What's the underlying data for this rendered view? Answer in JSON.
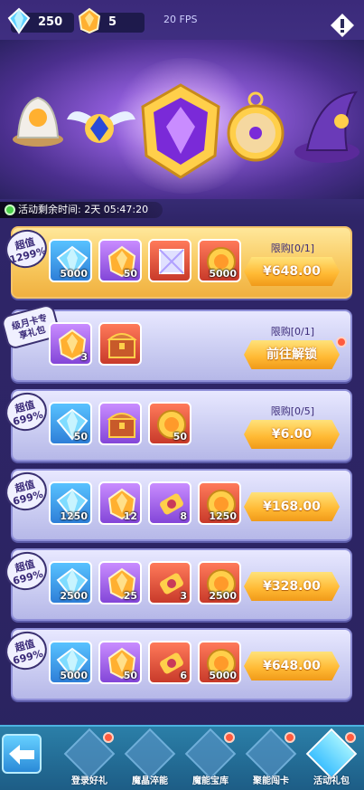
{
  "resources": {
    "crystal": "250",
    "amber": "5"
  },
  "fps": "20 FPS",
  "timer": "活动剩余时间: 2天 05:47:20",
  "packs": [
    {
      "badge": "超值\n1299%",
      "limit": "限购[0/1]",
      "price": "¥648.00",
      "items": [
        {
          "type": "crystal",
          "color": "blue",
          "qty": "5000"
        },
        {
          "type": "amber",
          "color": "purple",
          "qty": "50"
        },
        {
          "type": "box",
          "color": "red",
          "qty": ""
        },
        {
          "type": "coin",
          "color": "red",
          "qty": "5000"
        }
      ]
    },
    {
      "badge": "级月卡专\n享礼包",
      "limit": "限购[0/1]",
      "price": "前往解锁",
      "items": [
        {
          "type": "amber",
          "color": "purple",
          "qty": "3"
        },
        {
          "type": "chest",
          "color": "red",
          "qty": ""
        }
      ]
    },
    {
      "badge": "超值\n699%",
      "limit": "限购[0/5]",
      "price": "¥6.00",
      "items": [
        {
          "type": "crystal",
          "color": "blue",
          "qty": "50"
        },
        {
          "type": "chest",
          "color": "purple",
          "qty": ""
        },
        {
          "type": "coin",
          "color": "red",
          "qty": "50"
        }
      ]
    },
    {
      "badge": "超值\n699%",
      "limit": "",
      "price": "¥168.00",
      "items": [
        {
          "type": "crystal",
          "color": "blue",
          "qty": "1250"
        },
        {
          "type": "amber",
          "color": "purple",
          "qty": "12"
        },
        {
          "type": "scroll",
          "color": "purple",
          "qty": "8"
        },
        {
          "type": "coin",
          "color": "red",
          "qty": "1250"
        }
      ]
    },
    {
      "badge": "超值\n699%",
      "limit": "",
      "price": "¥328.00",
      "items": [
        {
          "type": "crystal",
          "color": "blue",
          "qty": "2500"
        },
        {
          "type": "amber",
          "color": "purple",
          "qty": "25"
        },
        {
          "type": "scroll",
          "color": "red",
          "qty": "3"
        },
        {
          "type": "coin",
          "color": "red",
          "qty": "2500"
        }
      ]
    },
    {
      "badge": "超值\n699%",
      "limit": "",
      "price": "¥648.00",
      "items": [
        {
          "type": "crystal",
          "color": "blue",
          "qty": "5000"
        },
        {
          "type": "amber",
          "color": "purple",
          "qty": "50"
        },
        {
          "type": "scroll",
          "color": "red",
          "qty": "6"
        },
        {
          "type": "coin",
          "color": "red",
          "qty": "5000"
        }
      ]
    }
  ],
  "tabs": [
    "登录好礼",
    "魔晶淬能",
    "魔能宝库",
    "聚能闯卡",
    "活动礼包"
  ]
}
